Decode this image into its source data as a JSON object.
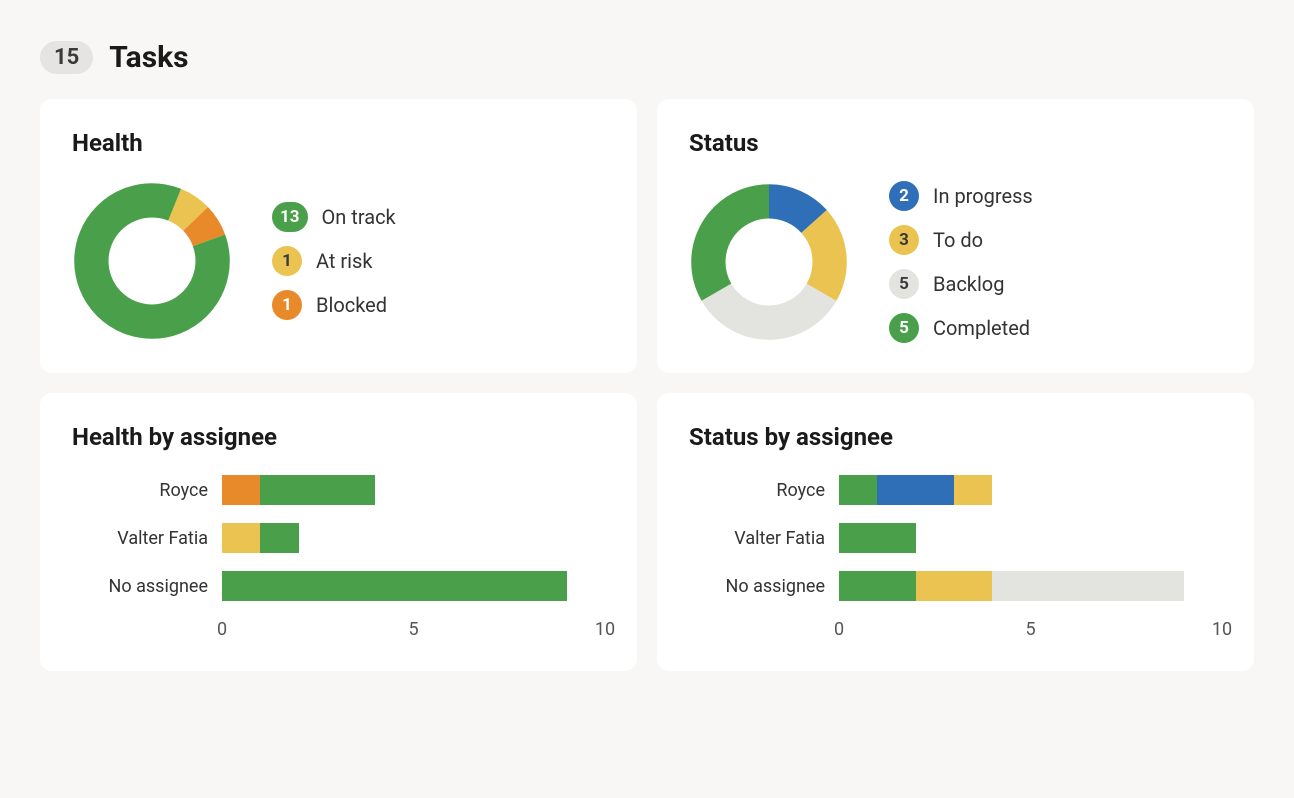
{
  "header": {
    "count": "15",
    "title": "Tasks"
  },
  "colors": {
    "green": "#4aa04a",
    "yellow": "#ebc351",
    "orange": "#e88a2a",
    "blue": "#2e6fb8",
    "grey": "#e3e3e0",
    "badgeDarkText": "#3a3a3a"
  },
  "cards": {
    "health": {
      "title": "Health",
      "legend": [
        {
          "count": "13",
          "label": "On track",
          "colorKey": "green",
          "textLight": true
        },
        {
          "count": "1",
          "label": "At risk",
          "colorKey": "yellow",
          "textLight": false
        },
        {
          "count": "1",
          "label": "Blocked",
          "colorKey": "orange",
          "textLight": true
        }
      ]
    },
    "status": {
      "title": "Status",
      "legend": [
        {
          "count": "2",
          "label": "In progress",
          "colorKey": "blue",
          "textLight": true
        },
        {
          "count": "3",
          "label": "To do",
          "colorKey": "yellow",
          "textLight": false
        },
        {
          "count": "5",
          "label": "Backlog",
          "colorKey": "grey",
          "textLight": false
        },
        {
          "count": "5",
          "label": "Completed",
          "colorKey": "green",
          "textLight": true
        }
      ]
    },
    "healthByAssignee": {
      "title": "Health by assignee",
      "xmax": 10,
      "ticks": [
        "0",
        "5",
        "10"
      ],
      "rows": [
        {
          "label": "Royce",
          "segments": [
            {
              "colorKey": "orange",
              "value": 1
            },
            {
              "colorKey": "green",
              "value": 3
            }
          ]
        },
        {
          "label": "Valter Fatia",
          "segments": [
            {
              "colorKey": "yellow",
              "value": 1
            },
            {
              "colorKey": "green",
              "value": 1
            }
          ]
        },
        {
          "label": "No assignee",
          "segments": [
            {
              "colorKey": "green",
              "value": 9
            }
          ]
        }
      ]
    },
    "statusByAssignee": {
      "title": "Status by assignee",
      "xmax": 10,
      "ticks": [
        "0",
        "5",
        "10"
      ],
      "rows": [
        {
          "label": "Royce",
          "segments": [
            {
              "colorKey": "green",
              "value": 1
            },
            {
              "colorKey": "blue",
              "value": 2
            },
            {
              "colorKey": "yellow",
              "value": 1
            }
          ]
        },
        {
          "label": "Valter Fatia",
          "segments": [
            {
              "colorKey": "green",
              "value": 2
            }
          ]
        },
        {
          "label": "No assignee",
          "segments": [
            {
              "colorKey": "green",
              "value": 2
            },
            {
              "colorKey": "yellow",
              "value": 2
            },
            {
              "colorKey": "grey",
              "value": 5
            }
          ]
        }
      ]
    }
  },
  "chart_data": [
    {
      "type": "pie",
      "title": "Health",
      "series": [
        {
          "name": "On track",
          "value": 13
        },
        {
          "name": "At risk",
          "value": 1
        },
        {
          "name": "Blocked",
          "value": 1
        }
      ]
    },
    {
      "type": "pie",
      "title": "Status",
      "series": [
        {
          "name": "In progress",
          "value": 2
        },
        {
          "name": "To do",
          "value": 3
        },
        {
          "name": "Backlog",
          "value": 5
        },
        {
          "name": "Completed",
          "value": 5
        }
      ]
    },
    {
      "type": "bar",
      "title": "Health by assignee",
      "xlabel": "",
      "ylabel": "",
      "xlim": [
        0,
        10
      ],
      "categories": [
        "Royce",
        "Valter Fatia",
        "No assignee"
      ],
      "series": [
        {
          "name": "On track",
          "values": [
            3,
            1,
            9
          ]
        },
        {
          "name": "At risk",
          "values": [
            0,
            1,
            0
          ]
        },
        {
          "name": "Blocked",
          "values": [
            1,
            0,
            0
          ]
        }
      ]
    },
    {
      "type": "bar",
      "title": "Status by assignee",
      "xlabel": "",
      "ylabel": "",
      "xlim": [
        0,
        10
      ],
      "categories": [
        "Royce",
        "Valter Fatia",
        "No assignee"
      ],
      "series": [
        {
          "name": "In progress",
          "values": [
            2,
            0,
            0
          ]
        },
        {
          "name": "To do",
          "values": [
            1,
            0,
            2
          ]
        },
        {
          "name": "Backlog",
          "values": [
            0,
            0,
            5
          ]
        },
        {
          "name": "Completed",
          "values": [
            1,
            2,
            2
          ]
        }
      ]
    }
  ]
}
